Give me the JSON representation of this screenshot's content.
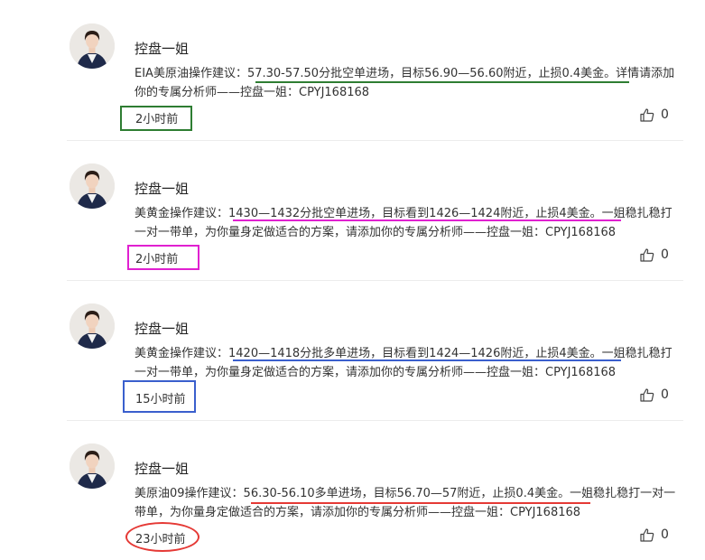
{
  "posts": [
    {
      "author": "控盘一姐",
      "content": "EIA美原油操作建议：57.30-57.50分批空单进场，目标56.90—56.60附近，止损0.4美金。详情请添加你的专属分析师——控盘一姐：CPYJ168168",
      "time": "2小时前",
      "likes": "0",
      "annotation": {
        "shape": "rectangle",
        "color": "#2e7d32"
      },
      "underline_color": "#2e7d32"
    },
    {
      "author": "控盘一姐",
      "content": "美黄金操作建议：1430—1432分批空单进场，目标看到1426—1424附近，止损4美金。一姐稳扎稳打一对一带单，为你量身定做适合的方案，请添加你的专属分析师——控盘一姐：CPYJ168168",
      "time": "2小时前",
      "likes": "0",
      "annotation": {
        "shape": "rectangle",
        "color": "#e020d0"
      },
      "underline_color": "#e020d0"
    },
    {
      "author": "控盘一姐",
      "content": "美黄金操作建议：1420—1418分批多单进场，目标看到1424—1426附近，止损4美金。一姐稳扎稳打一对一带单，为你量身定做适合的方案，请添加你的专属分析师——控盘一姐：CPYJ168168",
      "time": "15小时前",
      "likes": "0",
      "annotation": {
        "shape": "rectangle",
        "color": "#3a5fcd"
      },
      "underline_color": "#3a5fcd"
    },
    {
      "author": "控盘一姐",
      "content": "美原油09操作建议：56.30-56.10多单进场，目标56.70—57附近，止损0.4美金。一姐稳扎稳打一对一带单，为你量身定做适合的方案，请添加你的专属分析师——控盘一姐：CPYJ168168",
      "time": "23小时前",
      "likes": "0",
      "annotation": {
        "shape": "ellipse",
        "color": "#e53935"
      },
      "underline_color": "#e53935"
    }
  ],
  "icons": {
    "like": "thumbs-up-icon",
    "avatar": "avatar-photo"
  }
}
